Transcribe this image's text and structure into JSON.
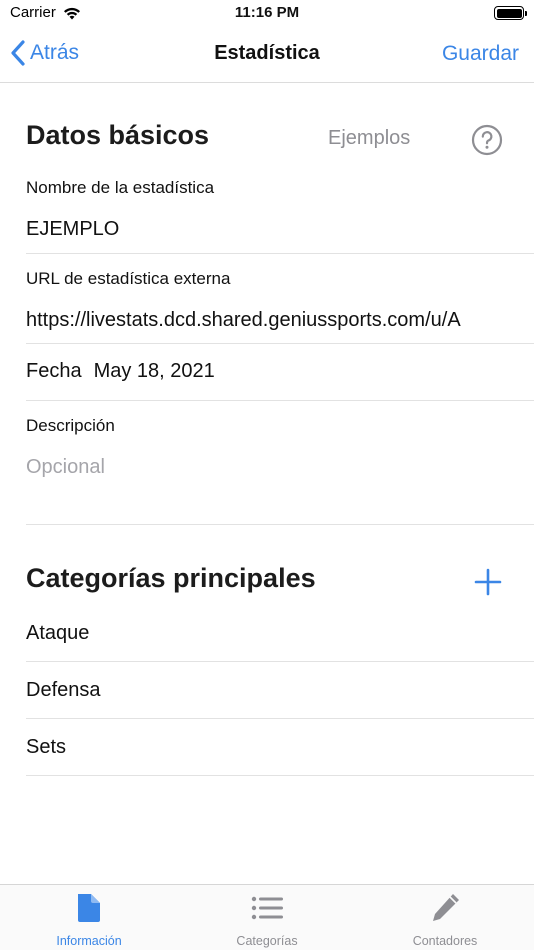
{
  "status_bar": {
    "carrier": "Carrier",
    "time": "11:16 PM"
  },
  "nav": {
    "back_label": "Atrás",
    "title": "Estadística",
    "save_label": "Guardar"
  },
  "basic_data": {
    "section_title": "Datos básicos",
    "examples_label": "Ejemplos",
    "name_label": "Nombre de la estadística",
    "name_value": "EJEMPLO",
    "url_label": "URL de estadística externa",
    "url_value": "https://livestats.dcd.shared.geniussports.com/u/A",
    "date_label": "Fecha",
    "date_value": "May 18, 2021",
    "description_label": "Descripción",
    "description_placeholder": "Opcional"
  },
  "categories": {
    "section_title": "Categorías principales",
    "items": [
      "Ataque",
      "Defensa",
      "Sets"
    ]
  },
  "tab_bar": {
    "tabs": [
      {
        "label": "Información",
        "icon": "document-icon",
        "active": true
      },
      {
        "label": "Categorías",
        "icon": "list-icon",
        "active": false
      },
      {
        "label": "Contadores",
        "icon": "pencil-icon",
        "active": false
      }
    ]
  },
  "colors": {
    "accent": "#3b86e6",
    "secondary_text": "#8e8e93"
  }
}
